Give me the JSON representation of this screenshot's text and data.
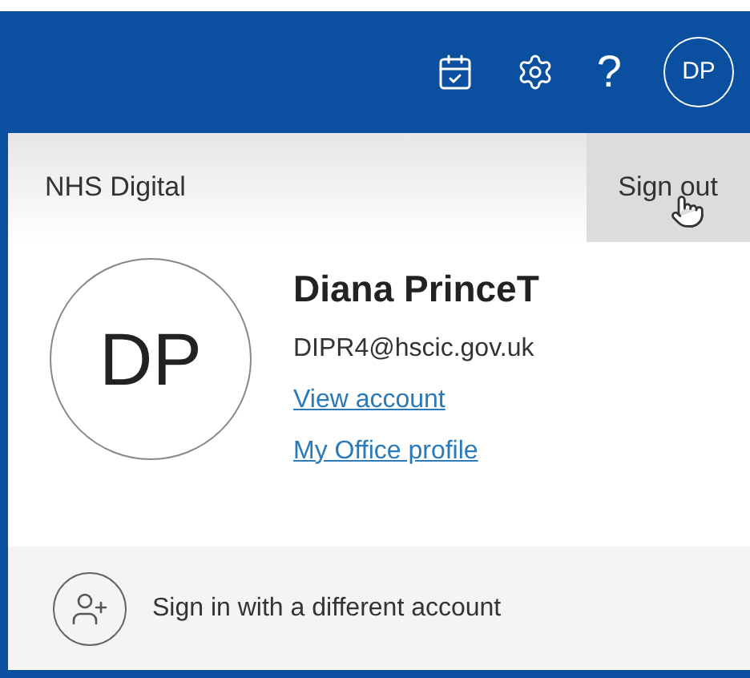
{
  "header": {
    "avatar_initials": "DP",
    "help": "?"
  },
  "org_bar": {
    "name": "NHS Digital",
    "sign_out": {
      "label": "Sign out",
      "hovered": true
    }
  },
  "account": {
    "initials": "DP",
    "name": "Diana PrinceT",
    "email": "DIPR4@hscic.gov.uk",
    "links": [
      "View account",
      "My Office profile"
    ]
  },
  "switch_account": {
    "label": "Sign in with a different account"
  }
}
